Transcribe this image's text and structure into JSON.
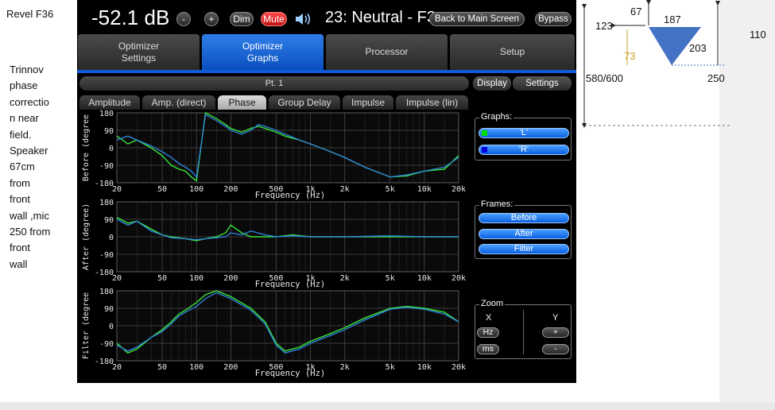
{
  "slide": {
    "title": "Revel F36",
    "note": [
      "Trinnov",
      "phase",
      "correctio",
      "n near",
      "field.",
      "Speaker",
      "67cm",
      "from",
      "front",
      "wall ,mic",
      "250 from",
      "front",
      "wall"
    ]
  },
  "topbar": {
    "volume": "-52.1 dB",
    "minus_label": "-",
    "plus_label": "+",
    "dim_label": "Dim",
    "mute_label": "Mute",
    "preset": "23: Neutral - F3",
    "back_label": "Back to Main Screen",
    "bypass_label": "Bypass"
  },
  "main_tabs": [
    {
      "label": "Optimizer Settings"
    },
    {
      "label": "Optimizer Graphs"
    },
    {
      "label": "Processor"
    },
    {
      "label": "Setup"
    }
  ],
  "point_label": "Pt. 1",
  "graph_tabs": [
    "Amplitude",
    "Amp. (direct)",
    "Phase",
    "Group Delay",
    "Impulse",
    "Impulse (lin)"
  ],
  "active_graph_tab": "Phase",
  "plots": [
    {
      "ylabel": "Before (degree"
    },
    {
      "ylabel": "After (degree)"
    },
    {
      "ylabel": "Filter (degree"
    }
  ],
  "chart_data": [
    {
      "type": "line",
      "xlabel": "Frequency (Hz)",
      "ylabel": "Before (degree",
      "xscale": "log",
      "xlim": [
        20,
        20000
      ],
      "ylim": [
        -180,
        180
      ],
      "xticks": [
        20,
        50,
        100,
        200,
        500,
        1000,
        2000,
        5000,
        10000,
        20000
      ],
      "xtick_labels": [
        "20",
        "50",
        "100",
        "200",
        "500",
        "1k",
        "2k",
        "5k",
        "10k",
        "20k"
      ],
      "yticks": [
        180,
        90,
        0,
        -90,
        -180
      ],
      "grid": true,
      "series": [
        {
          "name": "L",
          "x": [
            20,
            25,
            30,
            40,
            50,
            60,
            70,
            80,
            90,
            100,
            120,
            150,
            180,
            200,
            250,
            300,
            350,
            400,
            500,
            600,
            800,
            1000,
            1500,
            2000,
            3000,
            5000,
            7000,
            10000,
            15000,
            20000
          ],
          "y": [
            60,
            20,
            40,
            0,
            -40,
            -90,
            -110,
            -120,
            -150,
            -170,
            180,
            150,
            120,
            100,
            80,
            100,
            110,
            100,
            80,
            60,
            40,
            20,
            -20,
            -50,
            -100,
            -150,
            -145,
            -120,
            -110,
            -40
          ]
        },
        {
          "name": "R",
          "x": [
            20,
            25,
            30,
            40,
            50,
            60,
            70,
            80,
            90,
            100,
            120,
            150,
            180,
            200,
            250,
            300,
            350,
            400,
            500,
            600,
            800,
            1000,
            1500,
            2000,
            3000,
            5000,
            7000,
            10000,
            15000,
            20000
          ],
          "y": [
            40,
            60,
            40,
            10,
            -20,
            -50,
            -80,
            -100,
            -120,
            -150,
            170,
            140,
            110,
            90,
            70,
            90,
            120,
            110,
            90,
            70,
            40,
            20,
            -20,
            -50,
            -100,
            -150,
            -140,
            -120,
            -100,
            -50
          ]
        }
      ]
    },
    {
      "type": "line",
      "xlabel": "Frequency (Hz)",
      "ylabel": "After (degree)",
      "xscale": "log",
      "xlim": [
        20,
        20000
      ],
      "ylim": [
        -180,
        180
      ],
      "xticks": [
        20,
        50,
        100,
        200,
        500,
        1000,
        2000,
        5000,
        10000,
        20000
      ],
      "xtick_labels": [
        "20",
        "50",
        "100",
        "200",
        "500",
        "1k",
        "2k",
        "5k",
        "10k",
        "20k"
      ],
      "yticks": [
        180,
        90,
        0,
        -90,
        -180
      ],
      "grid": true,
      "series": [
        {
          "name": "L",
          "x": [
            20,
            25,
            30,
            40,
            50,
            60,
            80,
            100,
            120,
            150,
            180,
            200,
            250,
            300,
            400,
            500,
            700,
            1000,
            2000,
            5000,
            10000,
            20000
          ],
          "y": [
            100,
            70,
            80,
            40,
            10,
            0,
            -10,
            -20,
            -10,
            0,
            20,
            60,
            20,
            0,
            0,
            0,
            10,
            0,
            0,
            0,
            0,
            0
          ]
        },
        {
          "name": "R",
          "x": [
            20,
            25,
            30,
            40,
            50,
            60,
            80,
            100,
            120,
            150,
            180,
            200,
            250,
            300,
            400,
            500,
            700,
            1000,
            2000,
            5000,
            10000,
            20000
          ],
          "y": [
            90,
            60,
            80,
            30,
            10,
            -5,
            -10,
            -15,
            -10,
            -5,
            0,
            20,
            10,
            30,
            10,
            0,
            5,
            0,
            0,
            5,
            0,
            0
          ]
        }
      ]
    },
    {
      "type": "line",
      "xlabel": "Frequency (Hz)",
      "ylabel": "Filter (degree",
      "xscale": "log",
      "xlim": [
        20,
        20000
      ],
      "ylim": [
        -180,
        180
      ],
      "xticks": [
        20,
        50,
        100,
        200,
        500,
        1000,
        2000,
        5000,
        10000,
        20000
      ],
      "xtick_labels": [
        "20",
        "50",
        "100",
        "200",
        "500",
        "1k",
        "2k",
        "5k",
        "10k",
        "20k"
      ],
      "yticks": [
        180,
        90,
        0,
        -90,
        -180
      ],
      "grid": true,
      "series": [
        {
          "name": "L",
          "x": [
            20,
            25,
            30,
            40,
            50,
            60,
            70,
            80,
            100,
            120,
            150,
            200,
            300,
            400,
            500,
            600,
            800,
            1000,
            1500,
            2000,
            3000,
            5000,
            7000,
            10000,
            15000,
            20000
          ],
          "y": [
            -90,
            -140,
            -120,
            -60,
            -20,
            20,
            60,
            80,
            120,
            160,
            180,
            150,
            90,
            20,
            -90,
            -130,
            -110,
            -80,
            -40,
            -10,
            40,
            90,
            100,
            90,
            70,
            20
          ]
        },
        {
          "name": "R",
          "x": [
            20,
            25,
            30,
            40,
            50,
            60,
            70,
            80,
            100,
            120,
            150,
            200,
            300,
            400,
            500,
            600,
            800,
            1000,
            1500,
            2000,
            3000,
            5000,
            7000,
            10000,
            15000,
            20000
          ],
          "y": [
            -100,
            -130,
            -110,
            -60,
            -30,
            10,
            50,
            70,
            100,
            140,
            170,
            140,
            80,
            10,
            -100,
            -140,
            -120,
            -90,
            -50,
            -20,
            30,
            85,
            95,
            85,
            60,
            20
          ]
        }
      ]
    }
  ],
  "colors": {
    "series_L": "#39e639",
    "series_R": "#2e82d6",
    "series_R_alt": "#1f56e0",
    "accent": "#0d5bd6",
    "mute": "#e02020"
  },
  "sidebar": {
    "tabs": [
      "Display",
      "Settings"
    ],
    "graphs_title": "Graphs:",
    "graphs": [
      {
        "label": "'L'",
        "color": "#00dd00"
      },
      {
        "label": "'R'",
        "color": "#0000dd"
      }
    ],
    "frames_title": "Frames:",
    "frames": [
      "Before",
      "After",
      "Filter"
    ],
    "zoom_title": "Zoom",
    "zoom_x": "X",
    "zoom_y": "Y",
    "zoom_hz": "Hz",
    "zoom_ms": "ms",
    "zoom_plus": "+",
    "zoom_minus": "-"
  },
  "diagram": {
    "labels": {
      "d67": "67",
      "d187": "187",
      "d123": "123",
      "d110": "110",
      "d73": "73",
      "d203": "203",
      "d580": "580/600",
      "d250": "250"
    },
    "colors": {
      "triangle": "#4472c4",
      "highlight": "#c9a227"
    }
  }
}
